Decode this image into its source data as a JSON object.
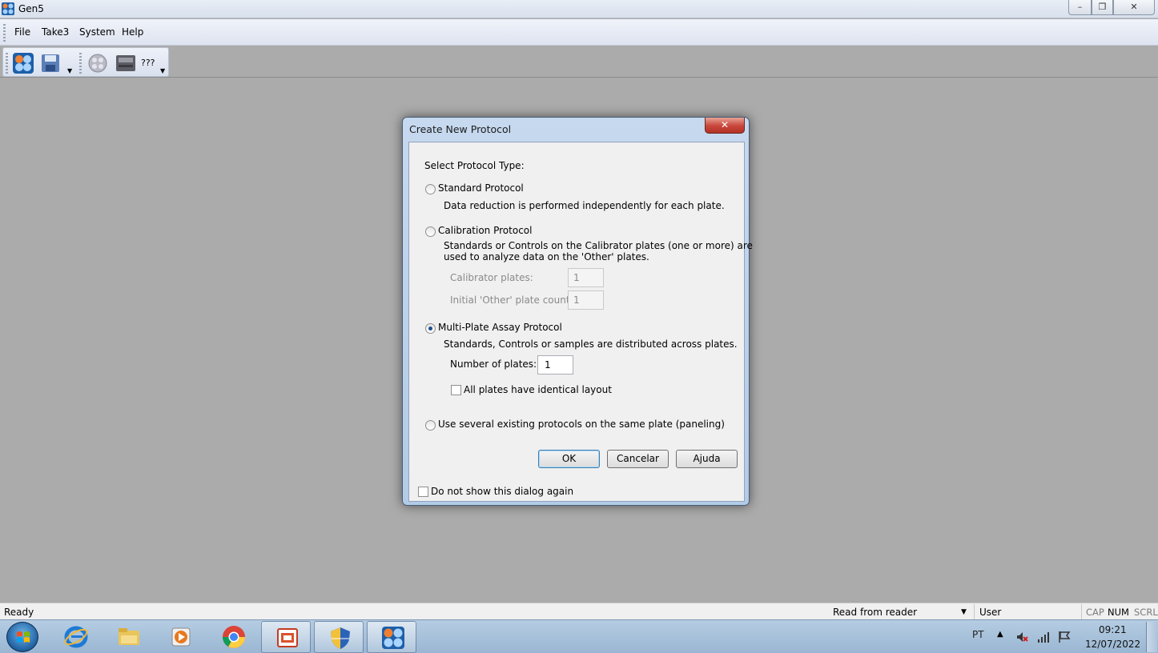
{
  "window": {
    "title": "Gen5"
  },
  "menu": {
    "items": [
      "File",
      "Take3",
      "System",
      "Help"
    ]
  },
  "toolbar": {
    "reader_label": "???"
  },
  "dialog": {
    "title": "Create New Protocol",
    "select_label": "Select Protocol Type:",
    "standard": {
      "label": "Standard Protocol",
      "description": "Data reduction is performed independently for each plate."
    },
    "calibration": {
      "label": "Calibration Protocol",
      "description_line1": "Standards or Controls on the Calibrator plates (one or more) are",
      "description_line2": "used to analyze data on the 'Other' plates.",
      "calibrator_plates_label": "Calibrator plates:",
      "calibrator_plates_value": "1",
      "other_count_label": "Initial 'Other' plate count:",
      "other_count_value": "1"
    },
    "multiplate": {
      "label": "Multi-Plate Assay Protocol",
      "description": "Standards, Controls or samples are distributed across plates.",
      "plates_label": "Number of plates:",
      "plates_value": "1",
      "identical_layout_label": "All plates have identical layout"
    },
    "paneling": {
      "label": "Use several existing protocols on the same plate (paneling)"
    },
    "selected_type": "multiplate",
    "buttons": {
      "ok": "OK",
      "cancel": "Cancelar",
      "help": "Ajuda"
    },
    "dont_show_label": "Do not show this dialog again"
  },
  "statusbar": {
    "status": "Ready",
    "reader_mode": "Read from reader",
    "user": "User",
    "cap": "CAP",
    "num": "NUM",
    "scrl": "SCRL"
  },
  "taskbar": {
    "language": "PT",
    "time": "09:21",
    "date": "12/07/2022"
  }
}
